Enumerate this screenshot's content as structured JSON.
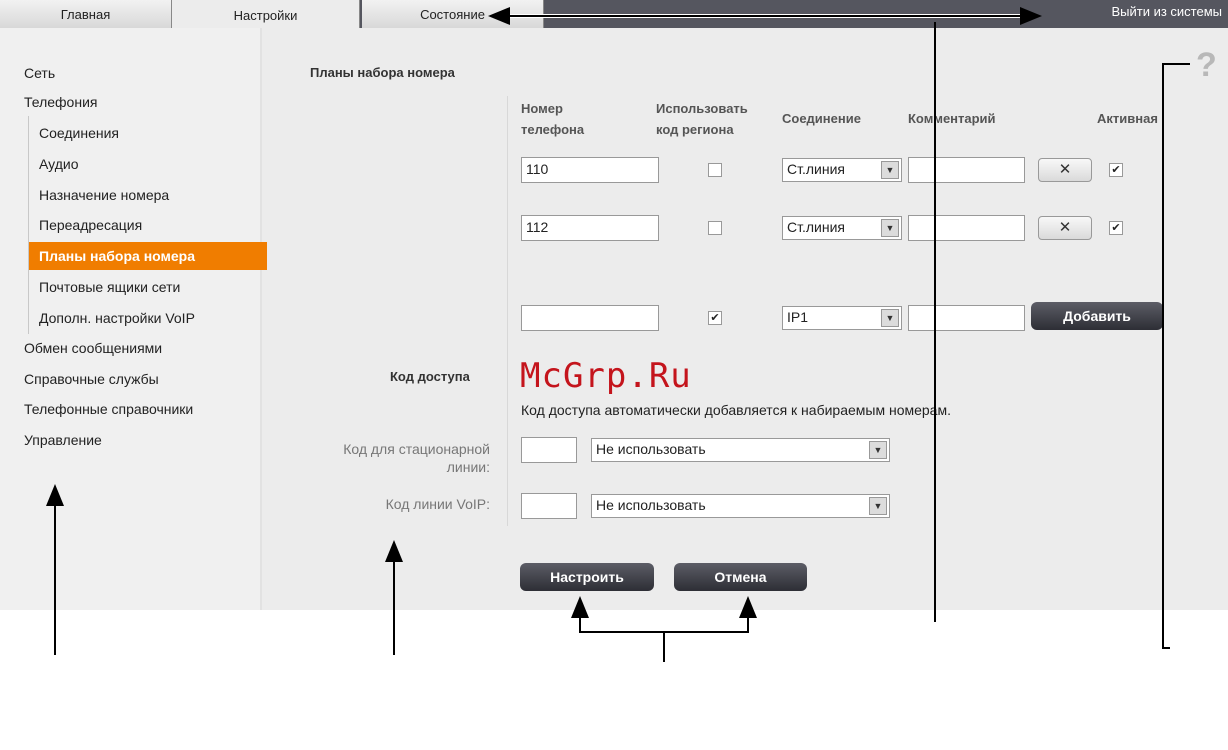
{
  "tabs": [
    {
      "label": "Главная"
    },
    {
      "label": "Настройки"
    },
    {
      "label": "Состояние"
    }
  ],
  "logout_label": "Выйти из системы",
  "sidebar": {
    "items": [
      {
        "label": "Сеть"
      },
      {
        "label": "Телефония"
      },
      {
        "label": "Соединения"
      },
      {
        "label": "Аудио"
      },
      {
        "label": "Назначение номера"
      },
      {
        "label": "Переадресация"
      },
      {
        "label": "Планы набора номера"
      },
      {
        "label": "Почтовые ящики сети"
      },
      {
        "label": "Дополн. настройки VoIP"
      },
      {
        "label": "Обмен сообщениями"
      },
      {
        "label": "Справочные службы"
      },
      {
        "label": "Телефонные справочники"
      },
      {
        "label": "Управление"
      }
    ]
  },
  "main": {
    "title": "Планы набора номера",
    "columns": {
      "phone_line1": "Номер",
      "phone_line2": "телефона",
      "area_line1": "Использовать",
      "area_line2": "код региона",
      "connection": "Соединение",
      "comment": "Комментарий",
      "active": "Активная"
    },
    "rows": [
      {
        "number": "110",
        "use_area_code": "",
        "connection": "Ст.линия",
        "comment": "",
        "delete": "✕",
        "active": "✔"
      },
      {
        "number": "112",
        "use_area_code": "",
        "connection": "Ст.линия",
        "comment": "",
        "delete": "✕",
        "active": "✔"
      }
    ],
    "new_row": {
      "number": "",
      "use_area_code": "✔",
      "connection": "IP1",
      "comment": "",
      "add_label": "Добавить"
    },
    "access": {
      "title": "Код доступа",
      "info": "Код доступа автоматически добавляется к набираемым номерам.",
      "landline_label_1": "Код для стационарной",
      "landline_label_2": "линии:",
      "landline_code": "",
      "landline_option": "Не использовать",
      "voip_label": "Код линии VoIP:",
      "voip_code": "",
      "voip_option": "Не использовать"
    },
    "apply_label": "Настроить",
    "cancel_label": "Отмена",
    "help_glyph": "?"
  },
  "watermark": "McGrp.Ru"
}
